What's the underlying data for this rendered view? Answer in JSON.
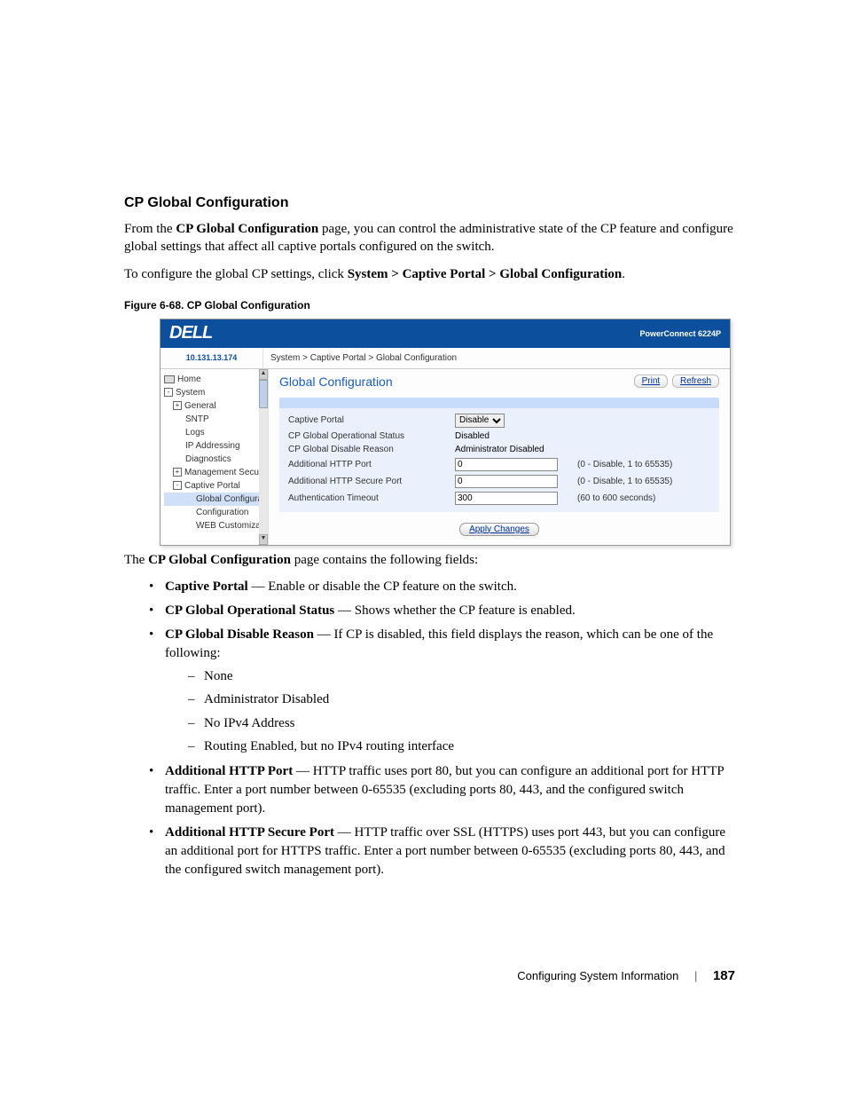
{
  "section_heading": "CP Global Configuration",
  "para1_pre": "From the ",
  "para1_bold": "CP Global Configuration",
  "para1_post": " page, you can control the administrative state of the CP feature and configure global settings that affect all captive portals configured on the switch.",
  "para2_pre": "To configure the global CP settings, click ",
  "para2_bold": "System > Captive Portal > Global Configuration",
  "para2_post": ".",
  "figure_caption": "Figure 6-68.    CP Global Configuration",
  "screenshot": {
    "logo": "DELL",
    "product": "PowerConnect 6224P",
    "ip": "10.131.13.174",
    "breadcrumb": "System > Captive Portal > Global Configuration",
    "title": "Global Configuration",
    "print": "Print",
    "refresh": "Refresh",
    "tree": {
      "home": "Home",
      "system": "System",
      "general": "General",
      "sntp": "SNTP",
      "logs": "Logs",
      "ipaddr": "IP Addressing",
      "diag": "Diagnostics",
      "mgmt": "Management Securit",
      "cp": "Captive Portal",
      "globalcfg": "Global Configurati",
      "cfg": "Configuration",
      "web": "WEB Customizat"
    },
    "form": {
      "r1l": "Captive Portal",
      "r1v": "Disable",
      "r2l": "CP Global Operational Status",
      "r2v": "Disabled",
      "r3l": "CP Global Disable Reason",
      "r3v": "Administrator Disabled",
      "r4l": "Additional HTTP Port",
      "r4v": "0",
      "r4h": "(0 - Disable, 1 to 65535)",
      "r5l": "Additional HTTP Secure Port",
      "r5v": "0",
      "r5h": "(0 - Disable, 1 to 65535)",
      "r6l": "Authentication Timeout",
      "r6v": "300",
      "r6h": "(60 to 600 seconds)"
    },
    "apply": "Apply Changes"
  },
  "para3_pre": "The ",
  "para3_bold": "CP Global Configuration",
  "para3_post": " page contains the following fields:",
  "b1_bold": "Captive Portal",
  "b1_rest": " — Enable or disable the CP feature on the switch.",
  "b2_bold": "CP Global Operational Status",
  "b2_rest": " — Shows whether the CP feature is enabled.",
  "b3_bold": "CP Global Disable Reason",
  "b3_rest": " — If CP is disabled, this field displays the reason, which can be one of the following:",
  "d1": "None",
  "d2": "Administrator Disabled",
  "d3": "No IPv4 Address",
  "d4": "Routing Enabled, but no IPv4 routing interface",
  "b4_bold": "Additional HTTP Port",
  "b4_rest": " — HTTP traffic uses port 80, but you can configure an additional port for HTTP traffic. Enter a port number between 0-65535 (excluding ports 80, 443, and the configured switch management port).",
  "b5_bold": "Additional HTTP Secure Port",
  "b5_rest": " — HTTP traffic over SSL (HTTPS) uses port 443, but you can configure an additional port for HTTPS traffic. Enter a port number between 0-65535 (excluding ports 80, 443, and the configured switch management port).",
  "footer_section": "Configuring System Information",
  "footer_page": "187"
}
